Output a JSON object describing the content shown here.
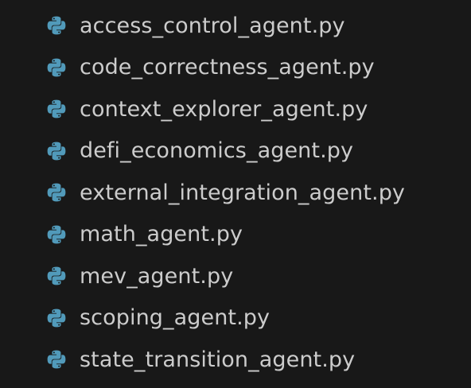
{
  "explorer": {
    "files": [
      {
        "name": "access_control_agent.py",
        "icon": "python-icon"
      },
      {
        "name": "code_correctness_agent.py",
        "icon": "python-icon"
      },
      {
        "name": "context_explorer_agent.py",
        "icon": "python-icon"
      },
      {
        "name": "defi_economics_agent.py",
        "icon": "python-icon"
      },
      {
        "name": "external_integration_agent.py",
        "icon": "python-icon"
      },
      {
        "name": "math_agent.py",
        "icon": "python-icon"
      },
      {
        "name": "mev_agent.py",
        "icon": "python-icon"
      },
      {
        "name": "scoping_agent.py",
        "icon": "python-icon"
      },
      {
        "name": "state_transition_agent.py",
        "icon": "python-icon"
      }
    ],
    "colors": {
      "background": "#181818",
      "text": "#cccccc",
      "icon": "#519aba"
    }
  }
}
